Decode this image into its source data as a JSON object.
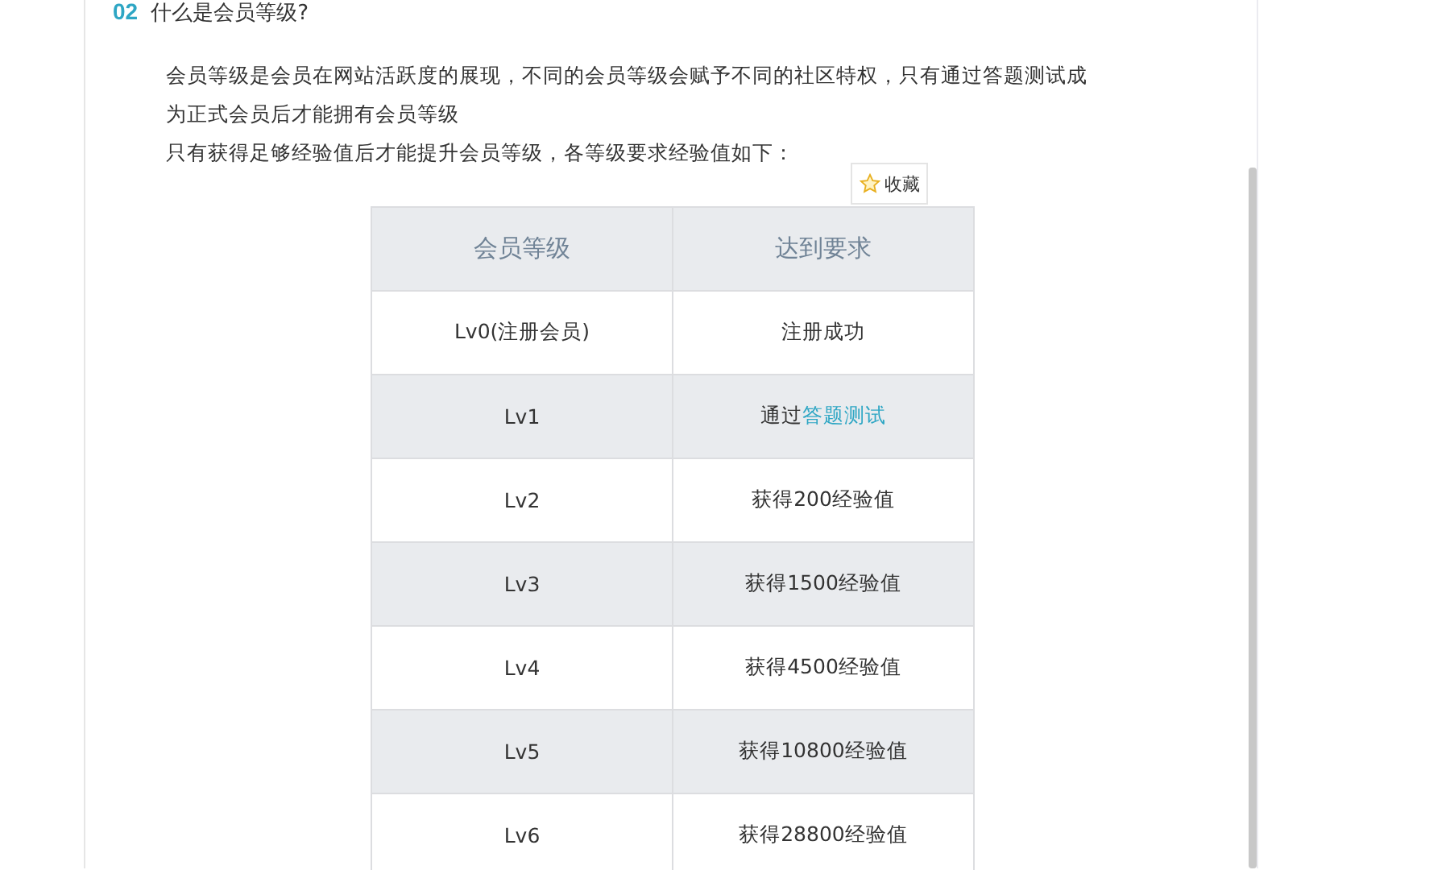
{
  "step": {
    "number": "02",
    "title": "什么是会员等级?"
  },
  "paragraphs": [
    "会员等级是会员在网站活跃度的展现，不同的会员等级会赋予不同的社区特权，只有通过答题测试成为正式会员后才能拥有会员等级",
    "只有获得足够经验值后才能提升会员等级，各等级要求经验值如下："
  ],
  "favorite_button": {
    "label": "收藏"
  },
  "table": {
    "columns": [
      "会员等级",
      "达到要求"
    ],
    "rows": [
      {
        "level": "Lv0(注册会员)",
        "requirement": {
          "text": "注册成功"
        }
      },
      {
        "level": "Lv1",
        "requirement": {
          "text": "通过",
          "link": "答题测试"
        }
      },
      {
        "level": "Lv2",
        "requirement": {
          "text": "获得200经验值"
        }
      },
      {
        "level": "Lv3",
        "requirement": {
          "text": "获得1500经验值"
        }
      },
      {
        "level": "Lv4",
        "requirement": {
          "text": "获得4500经验值"
        }
      },
      {
        "level": "Lv5",
        "requirement": {
          "text": "获得10800经验值"
        }
      },
      {
        "level": "Lv6",
        "requirement": {
          "text": "获得28800经验值"
        }
      }
    ]
  }
}
